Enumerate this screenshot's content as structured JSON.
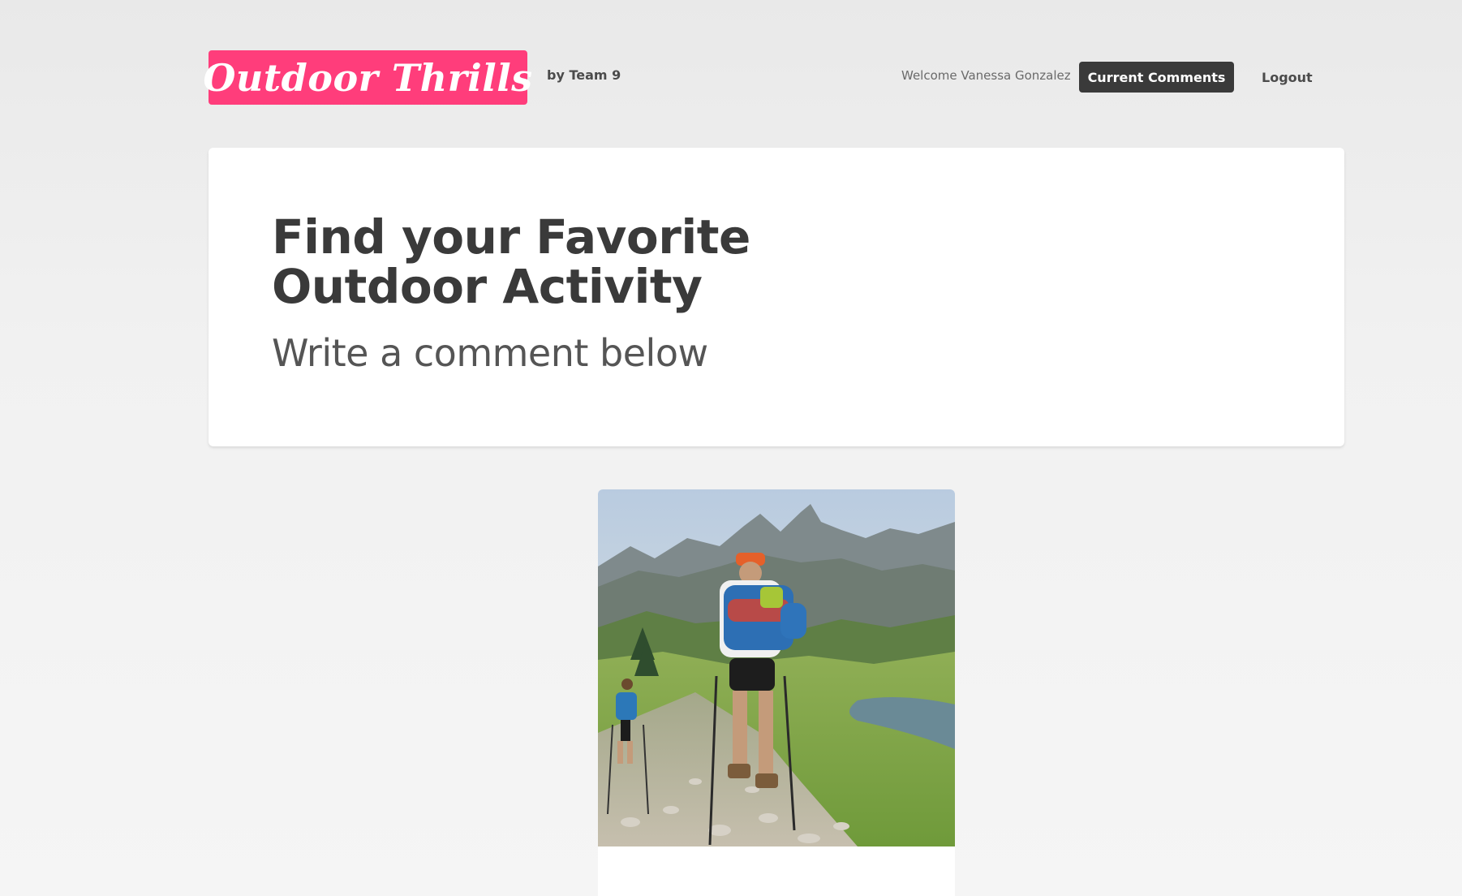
{
  "header": {
    "logo_text": "Outdoor Thrills",
    "byline": "by Team 9",
    "welcome_text": "Welcome Vanessa Gonzalez",
    "current_comments_label": "Current Comments",
    "logout_label": "Logout"
  },
  "hero": {
    "title_line1": "Find your Favorite",
    "title_line2": "Outdoor Activity",
    "subtitle": "Write a comment below"
  },
  "card": {
    "image_alt": "Hikers with backpacks and trekking poles on a rocky mountain trail"
  },
  "colors": {
    "brand_pink": "#ff3d7b",
    "button_dark": "#3a3a3a",
    "text_dark": "#3a3a3a"
  }
}
